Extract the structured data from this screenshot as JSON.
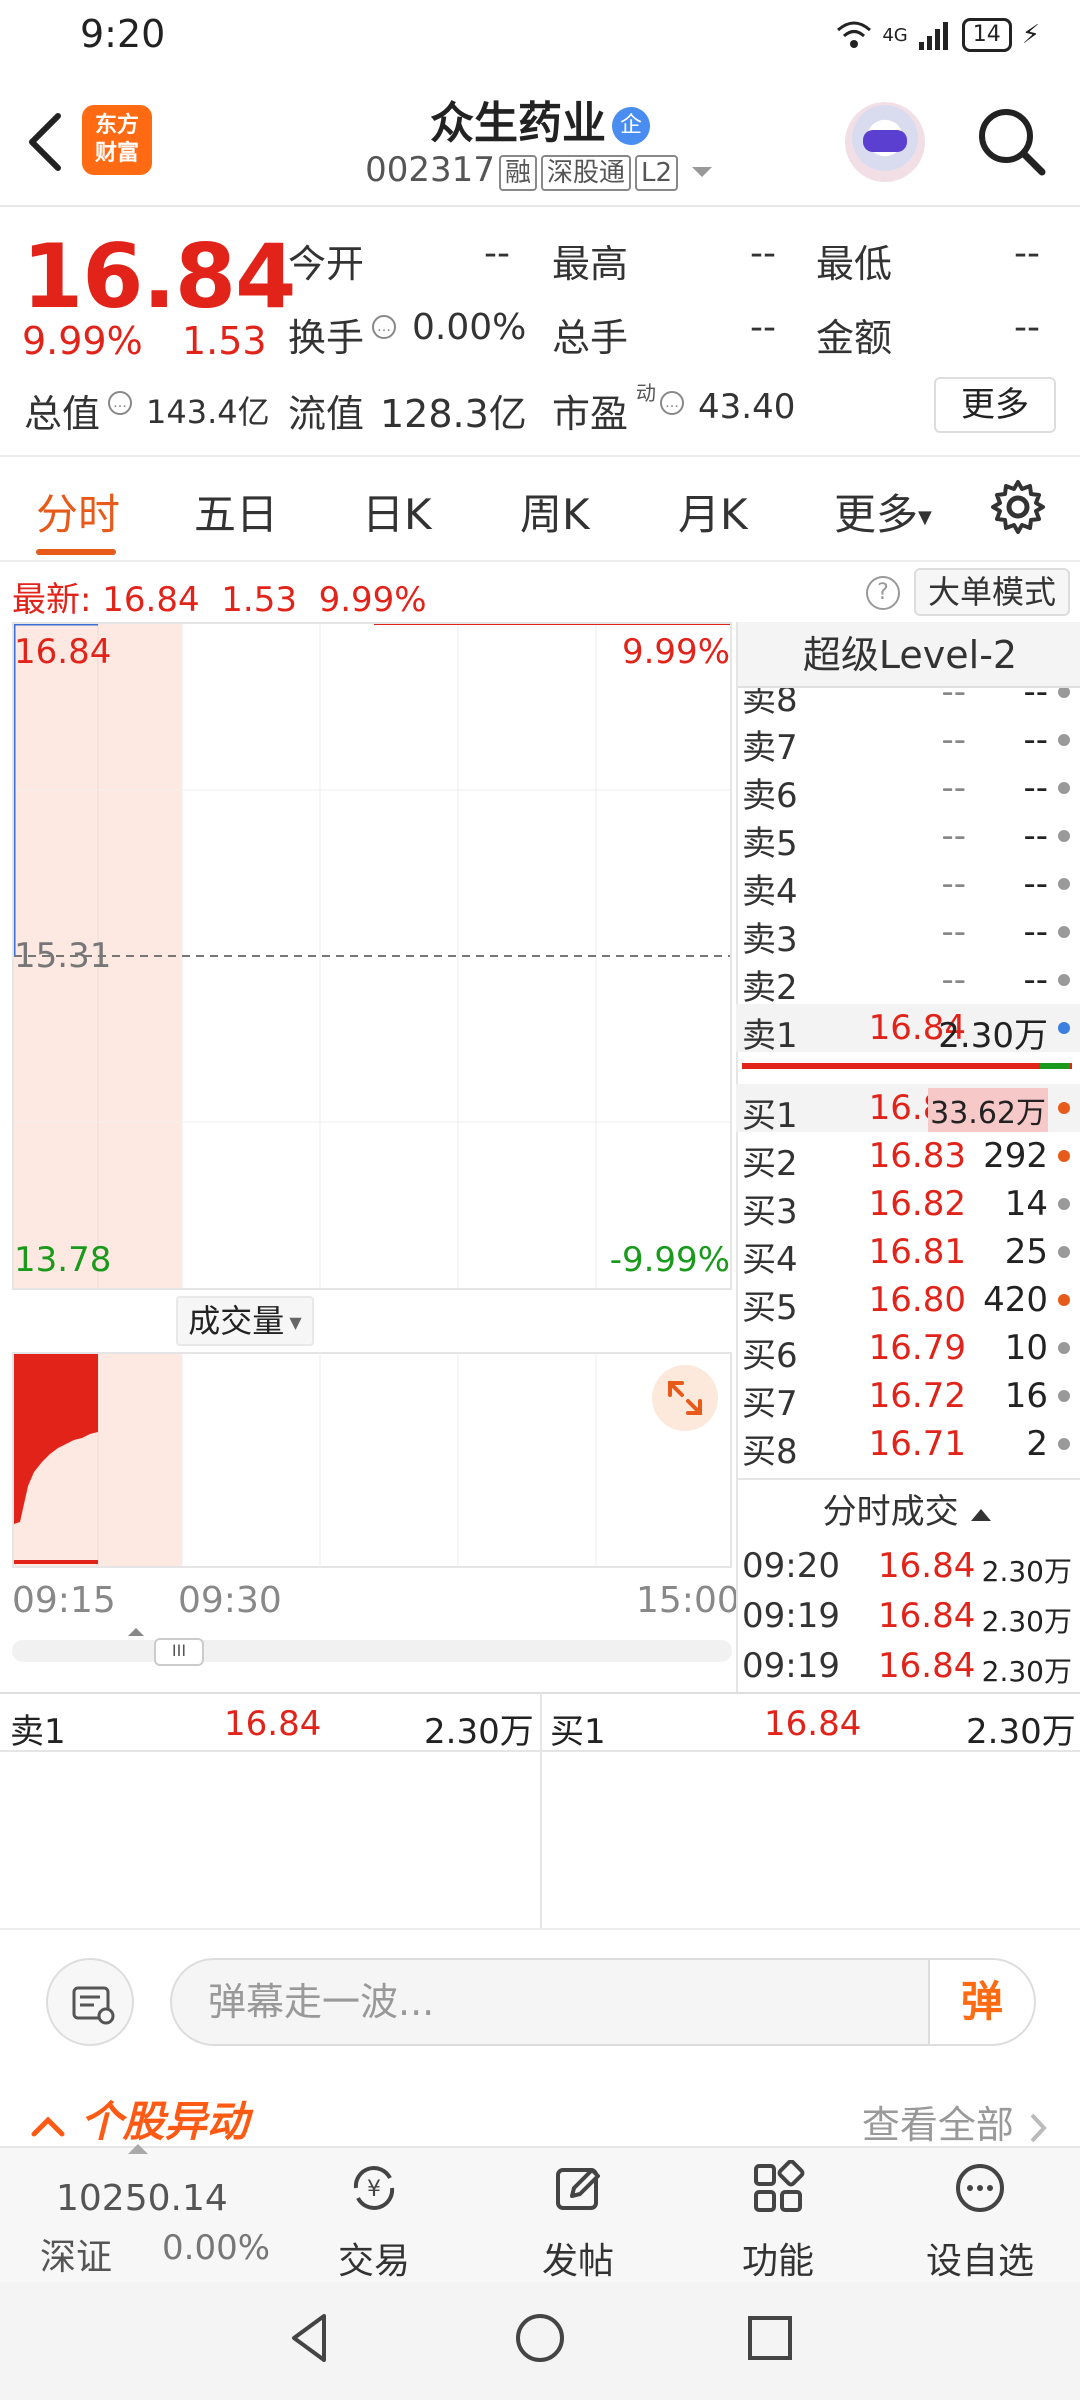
{
  "status": {
    "time": "9:20",
    "net": "4G",
    "battery": "14"
  },
  "header": {
    "logo": [
      "东方",
      "财富"
    ],
    "name": "众生药业",
    "ent_badge": "企",
    "code": "002317",
    "tags": [
      "融",
      "深股通",
      "L2"
    ]
  },
  "quote": {
    "price": "16.84",
    "pct": "9.99%",
    "change": "1.53",
    "fields": {
      "open_label": "今开",
      "open": "--",
      "high_label": "最高",
      "high": "--",
      "low_label": "最低",
      "low": "--",
      "turnover_label": "换手",
      "turnover": "0.00%",
      "volume_label": "总手",
      "volume": "--",
      "amount_label": "金额",
      "amount": "--",
      "mktcap_label": "总值",
      "mktcap": "143.4亿",
      "float_label": "流值",
      "float": "128.3亿",
      "pe_label": "市盈",
      "pe_sup": "动",
      "pe": "43.40"
    },
    "more": "更多"
  },
  "tabs": [
    "分时",
    "五日",
    "日K",
    "周K",
    "月K",
    "更多"
  ],
  "latest": {
    "label": "最新:",
    "price": "16.84",
    "change": "1.53",
    "pct": "9.99%",
    "big_order": "大单模式"
  },
  "chart": {
    "top_price": "16.84",
    "top_pct": "9.99%",
    "mid_price": "15.31",
    "bottom_price": "13.78",
    "bottom_pct": "-9.99%",
    "vol_label": "成交量",
    "times": [
      "09:15",
      "09:30",
      "15:00"
    ],
    "scroll_handle": "III"
  },
  "orderbook": {
    "title": "超级Level-2",
    "asks": [
      {
        "label": "卖8",
        "price": "--",
        "vol": "--"
      },
      {
        "label": "卖7",
        "price": "--",
        "vol": "--"
      },
      {
        "label": "卖6",
        "price": "--",
        "vol": "--"
      },
      {
        "label": "卖5",
        "price": "--",
        "vol": "--"
      },
      {
        "label": "卖4",
        "price": "--",
        "vol": "--"
      },
      {
        "label": "卖3",
        "price": "--",
        "vol": "--"
      },
      {
        "label": "卖2",
        "price": "--",
        "vol": "--"
      },
      {
        "label": "卖1",
        "price": "16.84",
        "vol": "2.30万"
      }
    ],
    "bids": [
      {
        "label": "买1",
        "price": "16.84",
        "vol": "33.62万"
      },
      {
        "label": "买2",
        "price": "16.83",
        "vol": "292"
      },
      {
        "label": "买3",
        "price": "16.82",
        "vol": "14"
      },
      {
        "label": "买4",
        "price": "16.81",
        "vol": "25"
      },
      {
        "label": "买5",
        "price": "16.80",
        "vol": "420"
      },
      {
        "label": "买6",
        "price": "16.79",
        "vol": "10"
      },
      {
        "label": "买7",
        "price": "16.72",
        "vol": "16"
      },
      {
        "label": "买8",
        "price": "16.71",
        "vol": "2"
      }
    ],
    "ticks_title": "分时成交",
    "ticks": [
      {
        "time": "09:20",
        "price": "16.84",
        "vol": "2.30万"
      },
      {
        "time": "09:19",
        "price": "16.84",
        "vol": "2.30万"
      },
      {
        "time": "09:19",
        "price": "16.84",
        "vol": "2.30万"
      }
    ]
  },
  "level1": {
    "ask_label": "卖1",
    "ask_price": "16.84",
    "ask_vol": "2.30万",
    "bid_label": "买1",
    "bid_price": "16.84",
    "bid_vol": "2.30万"
  },
  "danmu": {
    "placeholder": "弹幕走一波...",
    "send": "弹"
  },
  "movement": {
    "title": "个股异动",
    "view_all": "查看全部"
  },
  "bottomnav": {
    "index_value": "10250.14",
    "index_name": "深证",
    "index_pct": "0.00%",
    "items": [
      "交易",
      "发帖",
      "功能",
      "设自选"
    ]
  },
  "colors": {
    "up": "#e2231a",
    "down": "#1a9a1a",
    "accent": "#e85a1a",
    "brand": "#ff6a13"
  }
}
